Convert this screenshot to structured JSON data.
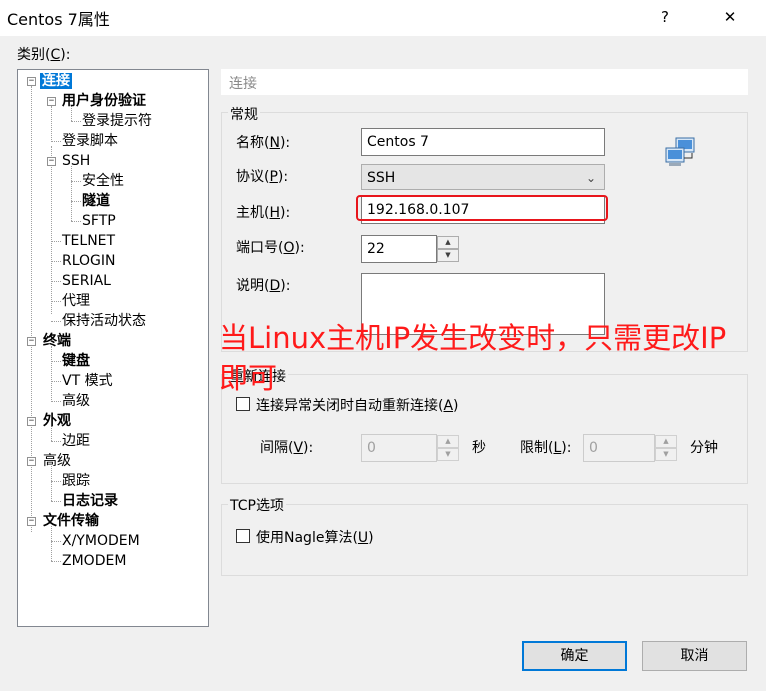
{
  "window": {
    "title": "Centos 7属性",
    "help": "?",
    "close": "✕"
  },
  "category_label": "类别(C):",
  "tree": [
    {
      "label": "连接",
      "bold": true,
      "selected": true
    },
    {
      "label": "用户身份验证",
      "bold": true
    },
    {
      "label": "登录提示符"
    },
    {
      "label": "登录脚本"
    },
    {
      "label": "SSH"
    },
    {
      "label": "安全性"
    },
    {
      "label": "隧道",
      "bold": true
    },
    {
      "label": "SFTP"
    },
    {
      "label": "TELNET"
    },
    {
      "label": "RLOGIN"
    },
    {
      "label": "SERIAL"
    },
    {
      "label": "代理"
    },
    {
      "label": "保持活动状态"
    },
    {
      "label": "终端",
      "bold": true
    },
    {
      "label": "键盘",
      "bold": true
    },
    {
      "label": "VT 模式"
    },
    {
      "label": "高级"
    },
    {
      "label": "外观",
      "bold": true
    },
    {
      "label": "边距"
    },
    {
      "label": "高级"
    },
    {
      "label": "跟踪"
    },
    {
      "label": "日志记录",
      "bold": true
    },
    {
      "label": "文件传输",
      "bold": true
    },
    {
      "label": "X/YMODEM"
    },
    {
      "label": "ZMODEM"
    }
  ],
  "panel_title": "连接",
  "general": {
    "group_label": "常规",
    "name_label": "名称(N):",
    "name_value": "Centos 7",
    "protocol_label": "协议(P):",
    "protocol_value": "SSH",
    "host_label": "主机(H):",
    "host_value": "192.168.0.107",
    "port_label": "端口号(O):",
    "port_value": "22",
    "desc_label": "说明(D):",
    "desc_value": ""
  },
  "reconnect": {
    "group_label": "重新连接",
    "checkbox_label": "连接异常关闭时自动重新连接(A)",
    "checked": false,
    "interval_label": "间隔(V):",
    "interval_value": "0",
    "interval_unit": "秒",
    "limit_label": "限制(L):",
    "limit_value": "0",
    "limit_unit": "分钟"
  },
  "tcp": {
    "group_label": "TCP选项",
    "nagle_label": "使用Nagle算法(U)",
    "checked": false
  },
  "annotation": "当Linux主机IP发生改变时，只需更改IP即可",
  "buttons": {
    "ok": "确定",
    "cancel": "取消"
  },
  "colors": {
    "selection": "#0078d7",
    "annotation": "#ff1a1a",
    "highlight_box": "#e8151b"
  }
}
